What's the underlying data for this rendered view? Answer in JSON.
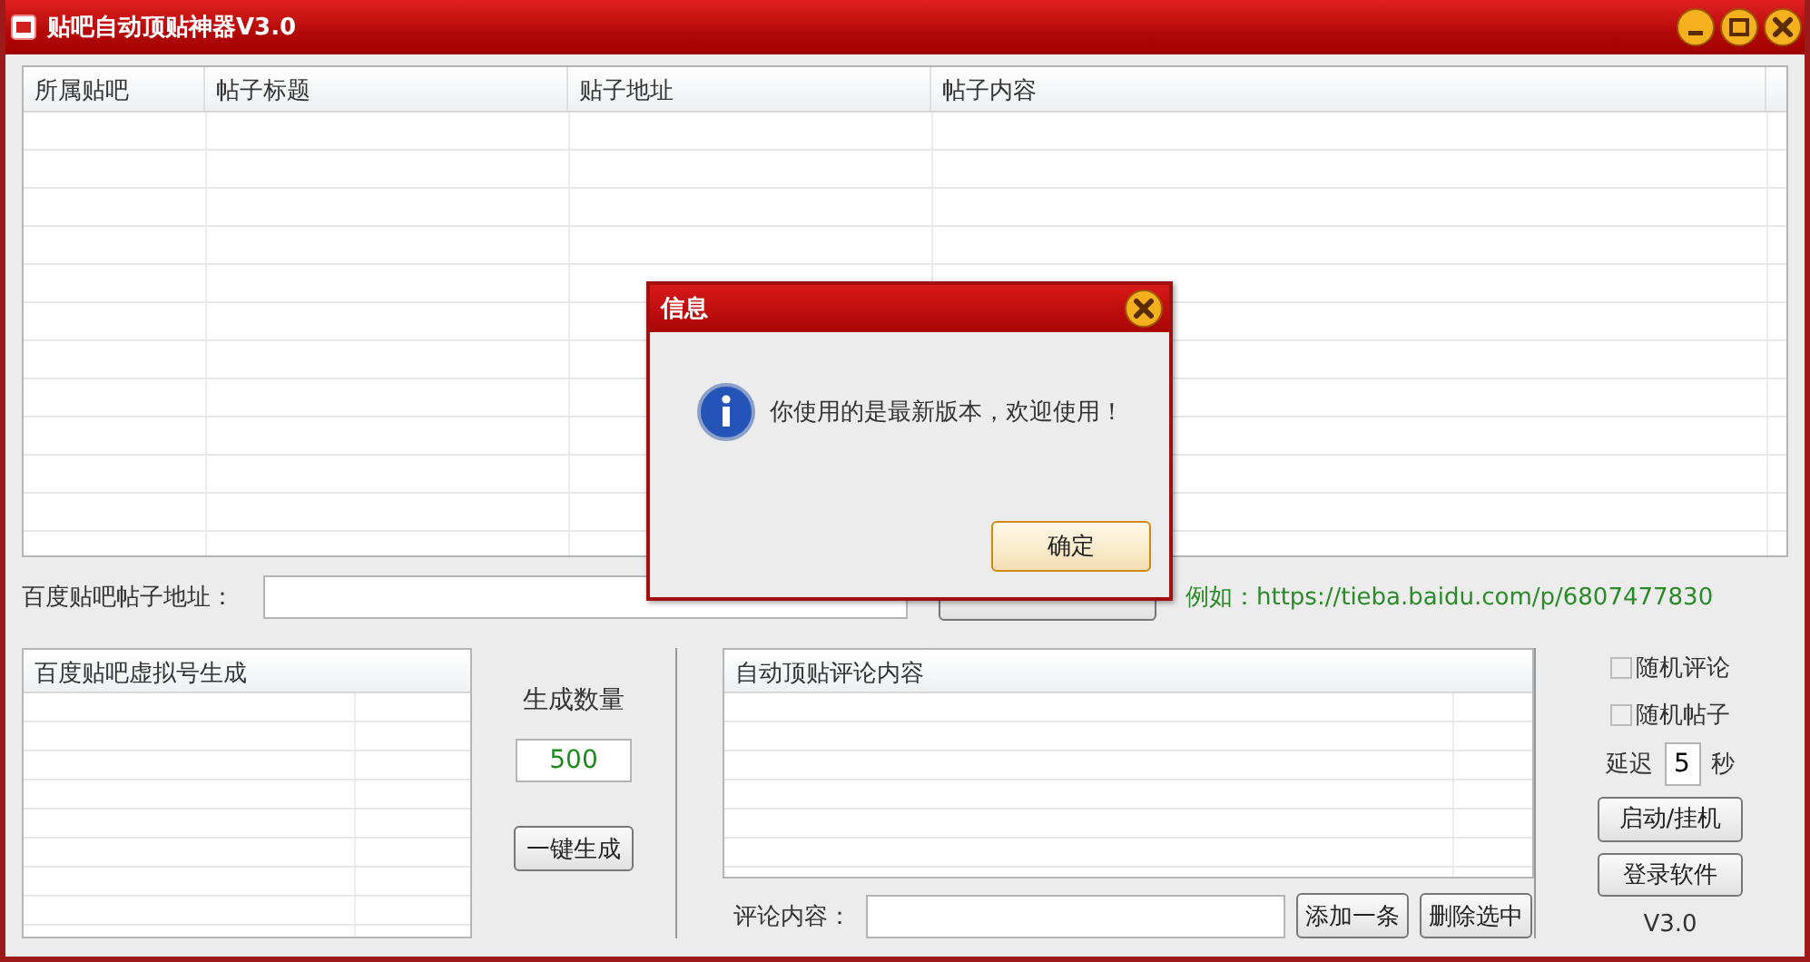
{
  "window": {
    "title": "贴吧自动顶贴神器V3.0"
  },
  "posts_table": {
    "columns": [
      "所属贴吧",
      "帖子标题",
      "贴子地址",
      "帖子内容"
    ]
  },
  "url_row": {
    "label": "百度贴吧帖子地址：",
    "example": "例如：https://tieba.baidu.com/p/6807477830"
  },
  "account_panel": {
    "header": "百度贴吧虚拟号生成",
    "count_label": "生成数量",
    "count_value": "500",
    "generate_button": "一键生成"
  },
  "comment_panel": {
    "header": "自动顶贴评论内容",
    "input_label": "评论内容：",
    "add_button": "添加一条",
    "delete_button": "删除选中"
  },
  "options": {
    "checkboxes": [
      {
        "label": "随机评论",
        "checked": false
      },
      {
        "label": "随机帖子",
        "checked": false
      }
    ],
    "delay_label": "延迟",
    "delay_value": "5",
    "delay_unit": "秒",
    "start_button": "启动/挂机",
    "login_button": "登录软件",
    "version": "V3.0"
  },
  "dialog": {
    "title": "信息",
    "message": "你使用的是最新版本，欢迎使用！",
    "ok_button": "确定"
  }
}
